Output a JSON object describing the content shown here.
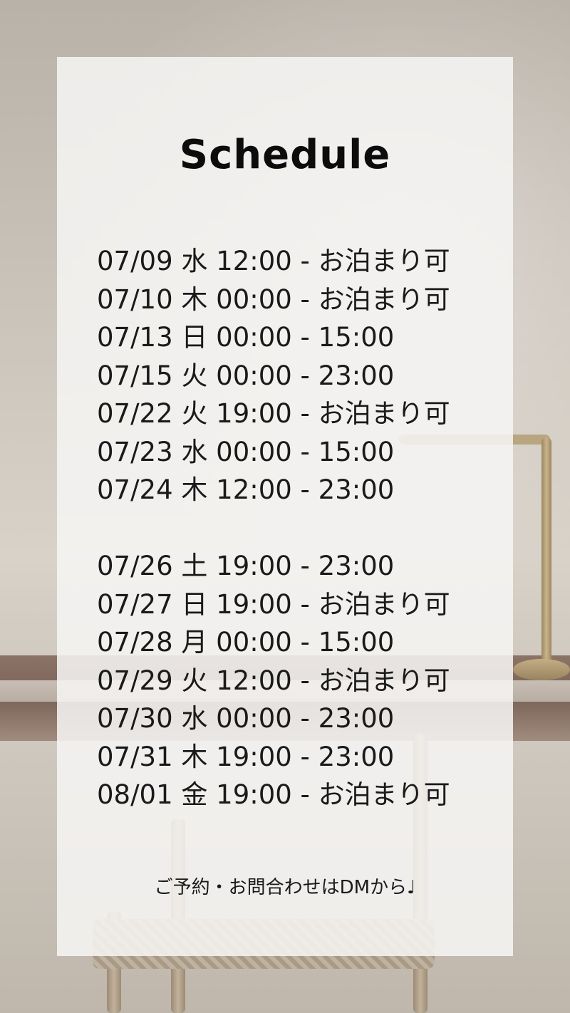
{
  "title": "Schedule",
  "schedule_group_1": [
    {
      "line": "07/09 水 12:00 - お泊まり可"
    },
    {
      "line": "07/10 木 00:00 - お泊まり可"
    },
    {
      "line": "07/13 日 00:00 - 15:00"
    },
    {
      "line": "07/15 火 00:00 - 23:00"
    },
    {
      "line": "07/22 火 19:00 - お泊まり可"
    },
    {
      "line": "07/23 水 00:00 - 15:00"
    },
    {
      "line": "07/24 木 12:00 - 23:00"
    }
  ],
  "schedule_group_2": [
    {
      "line": "07/26 土 19:00 - 23:00"
    },
    {
      "line": "07/27 日 19:00 - お泊まり可"
    },
    {
      "line": "07/28 月 00:00 - 15:00"
    },
    {
      "line": "07/29 火 12:00 - お泊まり可"
    },
    {
      "line": "07/30 水 00:00 - 23:00"
    },
    {
      "line": "07/31 木 19:00 - 23:00"
    },
    {
      "line": "08/01 金 19:00 - お泊まり可"
    }
  ],
  "footer": "ご予約・お問合わせはDMから♩"
}
